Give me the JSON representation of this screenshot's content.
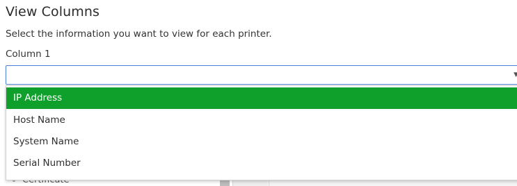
{
  "dialog": {
    "title": "View Columns",
    "description": "Select the information you want to view for each printer.",
    "column_label": "Column 1"
  },
  "select": {
    "value": "",
    "options": [
      {
        "label": "IP Address",
        "highlighted": true
      },
      {
        "label": "Host Name",
        "highlighted": false
      },
      {
        "label": "System Name",
        "highlighted": false
      },
      {
        "label": "Serial Number",
        "highlighted": false
      }
    ]
  },
  "background": {
    "partial_text": "Certificate"
  },
  "colors": {
    "highlight": "#0ea02a",
    "focus_border": "#4a7fd4"
  },
  "icons": {
    "dropdown": "chevron-down-icon"
  }
}
